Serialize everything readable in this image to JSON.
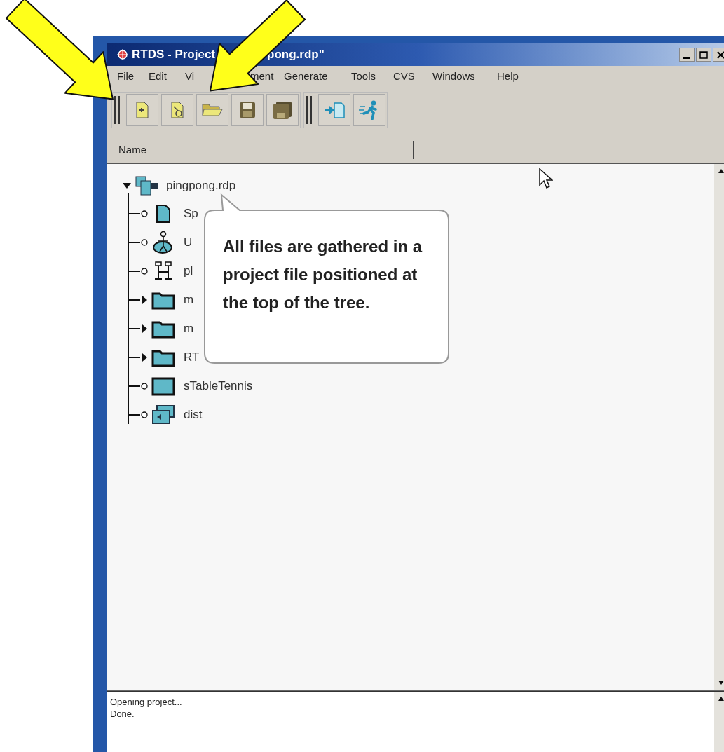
{
  "window": {
    "title_parts": [
      "RTDS - Project",
      "pong.rdp\""
    ]
  },
  "menu": [
    "File",
    "Edit",
    "Vi",
    "ment",
    "Generate",
    "Tools",
    "CVS",
    "Windows",
    "Help"
  ],
  "toolbar": {
    "groups": [
      {
        "buttons": [
          {
            "kind": "new-file"
          },
          {
            "kind": "new-diagram"
          },
          {
            "kind": "open"
          },
          {
            "kind": "save"
          },
          {
            "kind": "save-all"
          }
        ]
      },
      {
        "buttons": [
          {
            "kind": "import"
          },
          {
            "kind": "run"
          }
        ]
      }
    ]
  },
  "columns": [
    "Name"
  ],
  "tree": {
    "label": "pingpong.rdp",
    "kind": "project",
    "expanded": true,
    "children": [
      {
        "label": "Sp",
        "kind": "file"
      },
      {
        "label": "U",
        "kind": "usecase"
      },
      {
        "label": "pl",
        "kind": "architecture"
      },
      {
        "label": "m",
        "kind": "folder",
        "expanded": false
      },
      {
        "label": "m",
        "kind": "folder",
        "expanded": false
      },
      {
        "label": "RT",
        "kind": "folder",
        "expanded": false
      },
      {
        "label": "sTableTennis",
        "kind": "block"
      },
      {
        "label": "dist",
        "kind": "deployment"
      }
    ]
  },
  "callout": {
    "text": "All files are gathered in a project file positioned at the top of the tree."
  },
  "log": [
    "Opening project...",
    "Done."
  ]
}
